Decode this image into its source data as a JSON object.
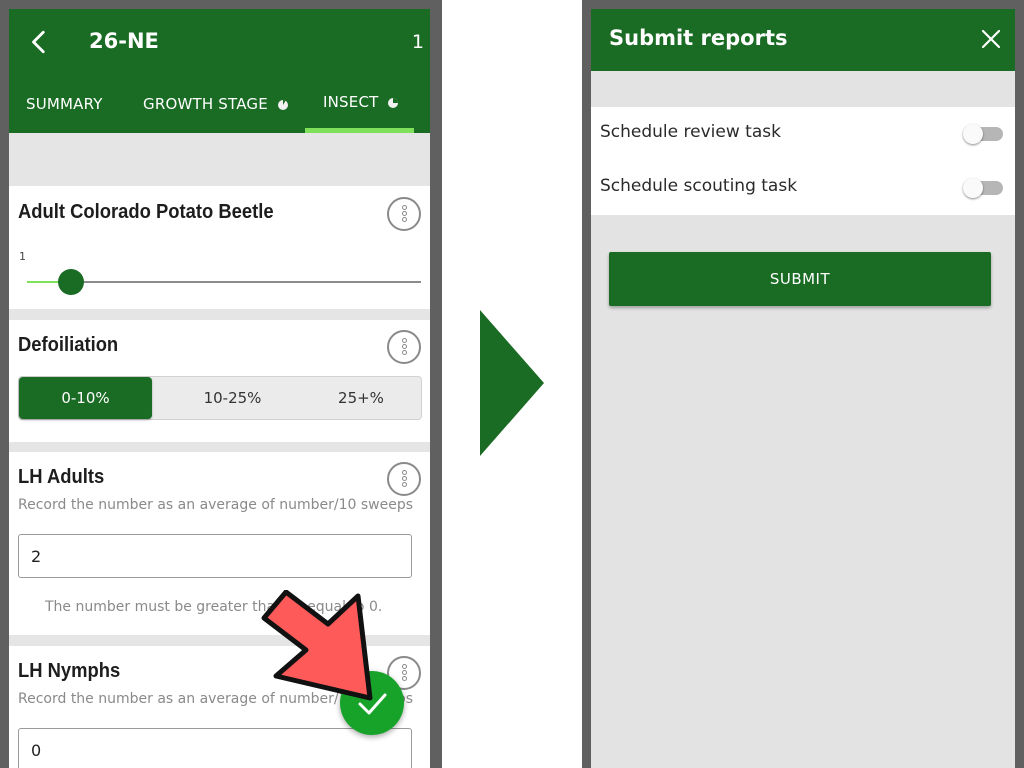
{
  "left_screen": {
    "header": {
      "back_icon": "arrow-left-icon",
      "title": "26-NE",
      "count": "1"
    },
    "tabs": [
      {
        "label": "SUMMARY",
        "active": false
      },
      {
        "label": "GROWTH STAGE",
        "active": false,
        "progress_icon": "pie-progress-icon"
      },
      {
        "label": "INSECT",
        "active": true,
        "progress_icon": "pie-progress-icon"
      }
    ],
    "cards": {
      "adult_cpb": {
        "title": "Adult Colorado Potato Beetle",
        "slider_value": "1",
        "menu_icon": "more-vertical-icon"
      },
      "defoliation": {
        "title": "Defoiliation",
        "options": [
          "0-10%",
          "10-25%",
          "25+%"
        ],
        "selected": "0-10%",
        "menu_icon": "more-vertical-icon"
      },
      "lh_adults": {
        "title": "LH Adults",
        "helper": "Record the number as an average of number/10 sweeps",
        "value": "2",
        "validation": "The number must be greater than or equal to 0.",
        "menu_icon": "more-vertical-icon"
      },
      "lh_nymphs": {
        "title": "LH Nymphs",
        "helper": "Record the number as an average of number/10 sweeps",
        "value": "0",
        "menu_icon": "more-vertical-icon"
      }
    },
    "fab_icon": "checkmark-icon",
    "annotation_icon": "red-pointer-arrow-icon"
  },
  "transition_icon": "right-triangle-arrow-icon",
  "right_screen": {
    "dialog": {
      "title": "Submit reports",
      "close_icon": "close-icon",
      "toggles": [
        {
          "label": "Schedule review task",
          "on": false
        },
        {
          "label": "Schedule scouting task",
          "on": false
        }
      ],
      "submit_label": "SUBMIT"
    }
  },
  "colors": {
    "primary_green": "#1a6b24",
    "accent_lime": "#7fe05a",
    "fab_green": "#17a32a",
    "pointer_red": "#ff5a5a"
  }
}
